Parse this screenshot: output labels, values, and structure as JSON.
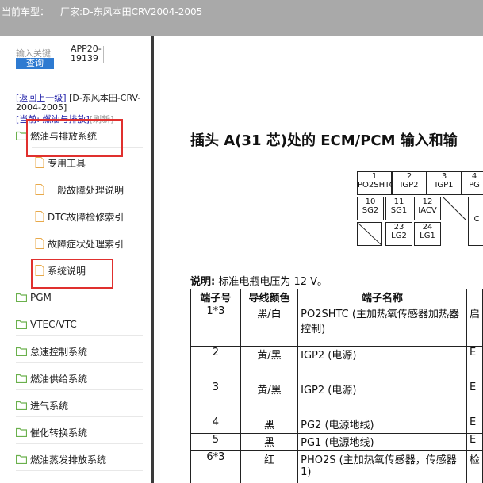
{
  "header": {
    "car_label": "当前车型：",
    "manufacturer": "厂家:D-东风本田CRV2004-2005"
  },
  "sidebar": {
    "keyword_label": "输入关键",
    "query_button": "查询",
    "app_code": "APP20-19139",
    "back_link": "[返回上一级]",
    "back_name": "[D-东风本田-CRV-2004-2005]",
    "current_label": "[当前: 燃油与排放]",
    "refresh": "[刷新]",
    "items": [
      {
        "label": "燃油与排放系统",
        "type": "folder"
      },
      {
        "label": "专用工具",
        "type": "doc"
      },
      {
        "label": "一般故障处理说明",
        "type": "doc"
      },
      {
        "label": "DTC故障检修索引",
        "type": "doc"
      },
      {
        "label": "故障症状处理索引",
        "type": "doc"
      },
      {
        "label": "系统说明",
        "type": "doc"
      },
      {
        "label": "PGM",
        "type": "folder"
      },
      {
        "label": "VTEC/VTC",
        "type": "folder"
      },
      {
        "label": "怠速控制系统",
        "type": "folder"
      },
      {
        "label": "燃油供给系统",
        "type": "folder"
      },
      {
        "label": "进气系统",
        "type": "folder"
      },
      {
        "label": "催化转换系统",
        "type": "folder"
      },
      {
        "label": "燃油蒸发排放系统",
        "type": "folder"
      }
    ]
  },
  "document": {
    "heading": "插头 A(31 芯)处的 ECM/PCM 输入和输",
    "connector_pins": [
      {
        "num": "1",
        "name": "PO2SHTC"
      },
      {
        "num": "2",
        "name": "IGP2"
      },
      {
        "num": "3",
        "name": "IGP1"
      },
      {
        "num": "4",
        "name": "PG"
      },
      {
        "num": "10",
        "name": "SG2"
      },
      {
        "num": "11",
        "name": "SG1"
      },
      {
        "num": "12",
        "name": "IACV"
      },
      {
        "num": "23",
        "name": "LG2"
      },
      {
        "num": "24",
        "name": "LG1"
      },
      {
        "num": "",
        "name": "C"
      }
    ],
    "note_label": "说明:",
    "note_text": "标准电瓶电压为 12 V。",
    "table": {
      "headers": [
        "端子号",
        "导线颜色",
        "端子名称"
      ],
      "rows": [
        {
          "num": "1*3",
          "color": "黑/白",
          "name": "PO2SHTC (主加热氧传感器加热器控制)",
          "extra": "启"
        },
        {
          "num": "2",
          "color": "黄/黑",
          "name": "IGP2 (电源)",
          "extra": "E"
        },
        {
          "num": "3",
          "color": "黄/黑",
          "name": "IGP2 (电源)",
          "extra": "E"
        },
        {
          "num": "4",
          "color": "黑",
          "name": "PG2 (电源地线)",
          "extra": "E"
        },
        {
          "num": "5",
          "color": "黑",
          "name": "PG1 (电源地线)",
          "extra": "E"
        },
        {
          "num": "6*3",
          "color": "红",
          "name": "PHO2S (主加热氧传感器，传感器 1)",
          "extra": "检"
        }
      ]
    }
  },
  "colors": {
    "topbar": "#a9a9a9",
    "link": "#1a1aa6",
    "query_button": "#2e7ad1",
    "highlight_box": "#e0302e",
    "folder_icon": "#6ab04c"
  }
}
